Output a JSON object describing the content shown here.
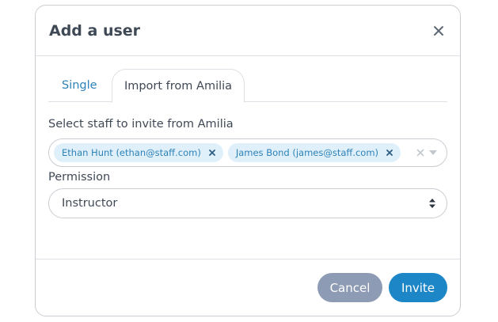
{
  "dialog": {
    "title": "Add a user",
    "close_icon": "close-icon"
  },
  "tabs": [
    {
      "label": "Single",
      "active": false
    },
    {
      "label": "Import from Amilia",
      "active": true
    }
  ],
  "staff": {
    "label": "Select staff to invite from Amilia",
    "selected": [
      {
        "label": "Ethan Hunt (ethan@staff.com)"
      },
      {
        "label": "James Bond (james@staff.com)"
      }
    ]
  },
  "permission": {
    "label": "Permission",
    "value": "Instructor"
  },
  "footer": {
    "cancel_label": "Cancel",
    "invite_label": "Invite"
  },
  "colors": {
    "accent": "#1c86c6",
    "cancel": "#8e9bb4",
    "chip_bg": "#dff0fa",
    "chip_text": "#2d82b7"
  }
}
